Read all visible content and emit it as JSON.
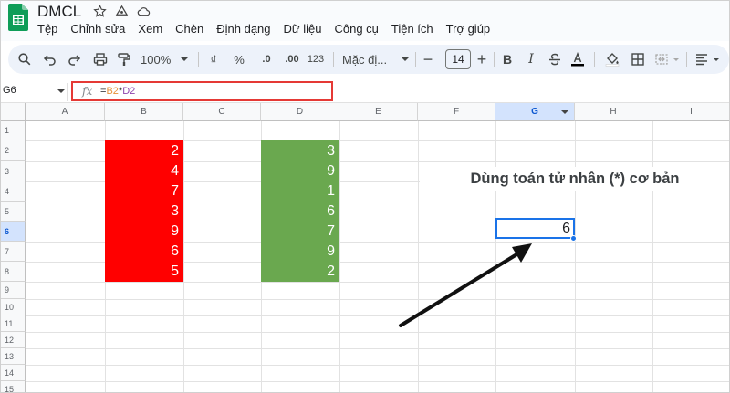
{
  "app": {
    "title": "DMCL"
  },
  "menu": [
    "Tệp",
    "Chỉnh sửa",
    "Xem",
    "Chèn",
    "Định dạng",
    "Dữ liệu",
    "Công cụ",
    "Tiện ích",
    "Trợ giúp"
  ],
  "toolbar": {
    "zoom": "100%",
    "currency": "₫",
    "percent": "%",
    "dec_decrease": ".0",
    "dec_increase": ".00",
    "number_format": "123",
    "font": "Mặc đị...",
    "font_size": "14"
  },
  "formula_bar": {
    "name_box": "G6",
    "fx": "fx",
    "eq": "=",
    "ref1": "B2",
    "op": "*",
    "ref2": "D2"
  },
  "columns": [
    "A",
    "B",
    "C",
    "D",
    "E",
    "F",
    "G",
    "H",
    "I"
  ],
  "rows": [
    "1",
    "2",
    "3",
    "4",
    "5",
    "6",
    "7",
    "8",
    "9",
    "10",
    "11",
    "12",
    "13",
    "14",
    "15"
  ],
  "column_b_values": [
    "2",
    "4",
    "7",
    "3",
    "9",
    "6",
    "5"
  ],
  "column_d_values": [
    "3",
    "9",
    "1",
    "6",
    "7",
    "9",
    "2"
  ],
  "caption": "Dùng toán tử nhân (*) cơ bản",
  "active_cell": {
    "ref": "G6",
    "value": "6"
  },
  "colors": {
    "red_fill": "#ff0000",
    "green_fill": "#6aa84f",
    "formula_highlight": "#e53935",
    "selection": "#1a73e8"
  }
}
